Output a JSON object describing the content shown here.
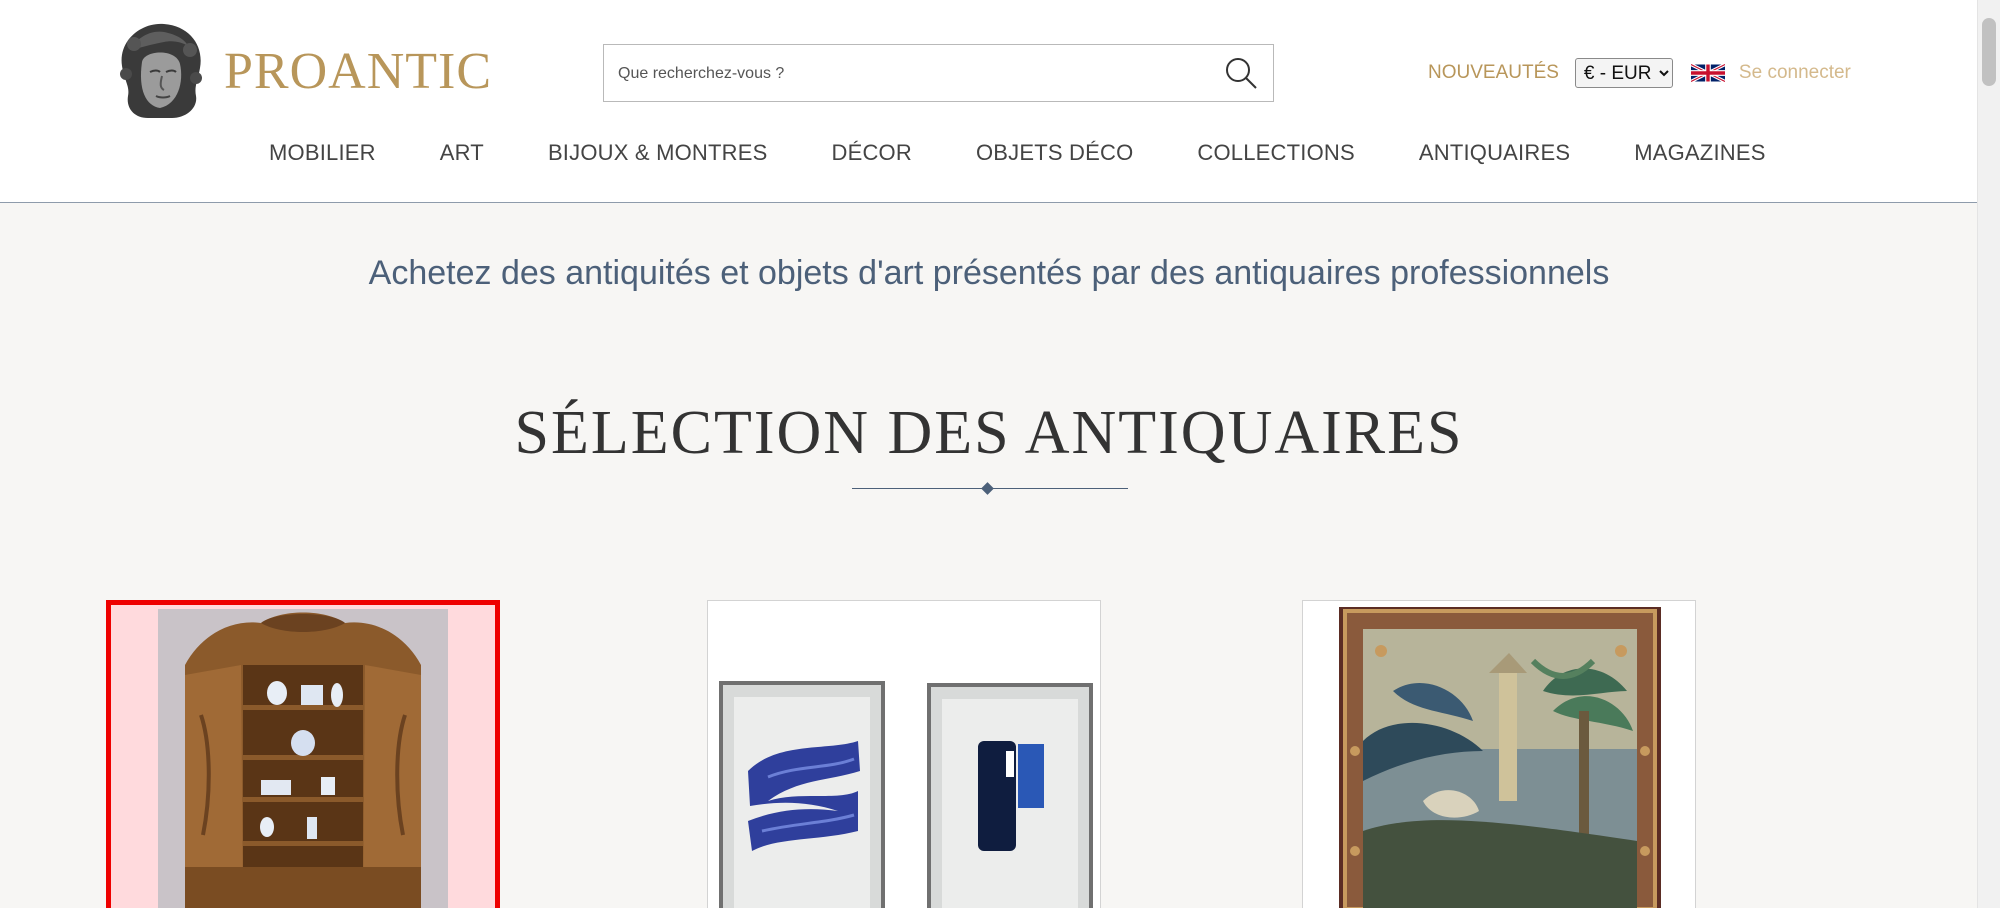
{
  "brand": {
    "name": "PROANTIC"
  },
  "search": {
    "placeholder": "Que recherchez-vous ?"
  },
  "top_links": {
    "new_label": "NOUVEAUTÉS",
    "currency_selected": "€ - EUR",
    "language_flag": "uk-flag-icon",
    "login_label": "Se connecter"
  },
  "nav": {
    "items": [
      "MOBILIER",
      "ART",
      "BIJOUX & MONTRES",
      "DÉCOR",
      "OBJETS DÉCO",
      "COLLECTIONS",
      "ANTIQUAIRES",
      "MAGAZINES"
    ]
  },
  "tagline": "Achetez des antiquités et objets d'art présentés par des antiquaires professionnels",
  "section": {
    "title": "SÉLECTION DES ANTIQUAIRES"
  },
  "cards": [
    {
      "subject": "carved-cabinet-image",
      "selected": true
    },
    {
      "subject": "abstract-prints-image",
      "selected": false
    },
    {
      "subject": "tapestry-image",
      "selected": false
    }
  ],
  "colors": {
    "gold": "#b8965a",
    "navy_text": "#4c6079",
    "selection": "#ee0000",
    "background": "#f7f6f4"
  }
}
